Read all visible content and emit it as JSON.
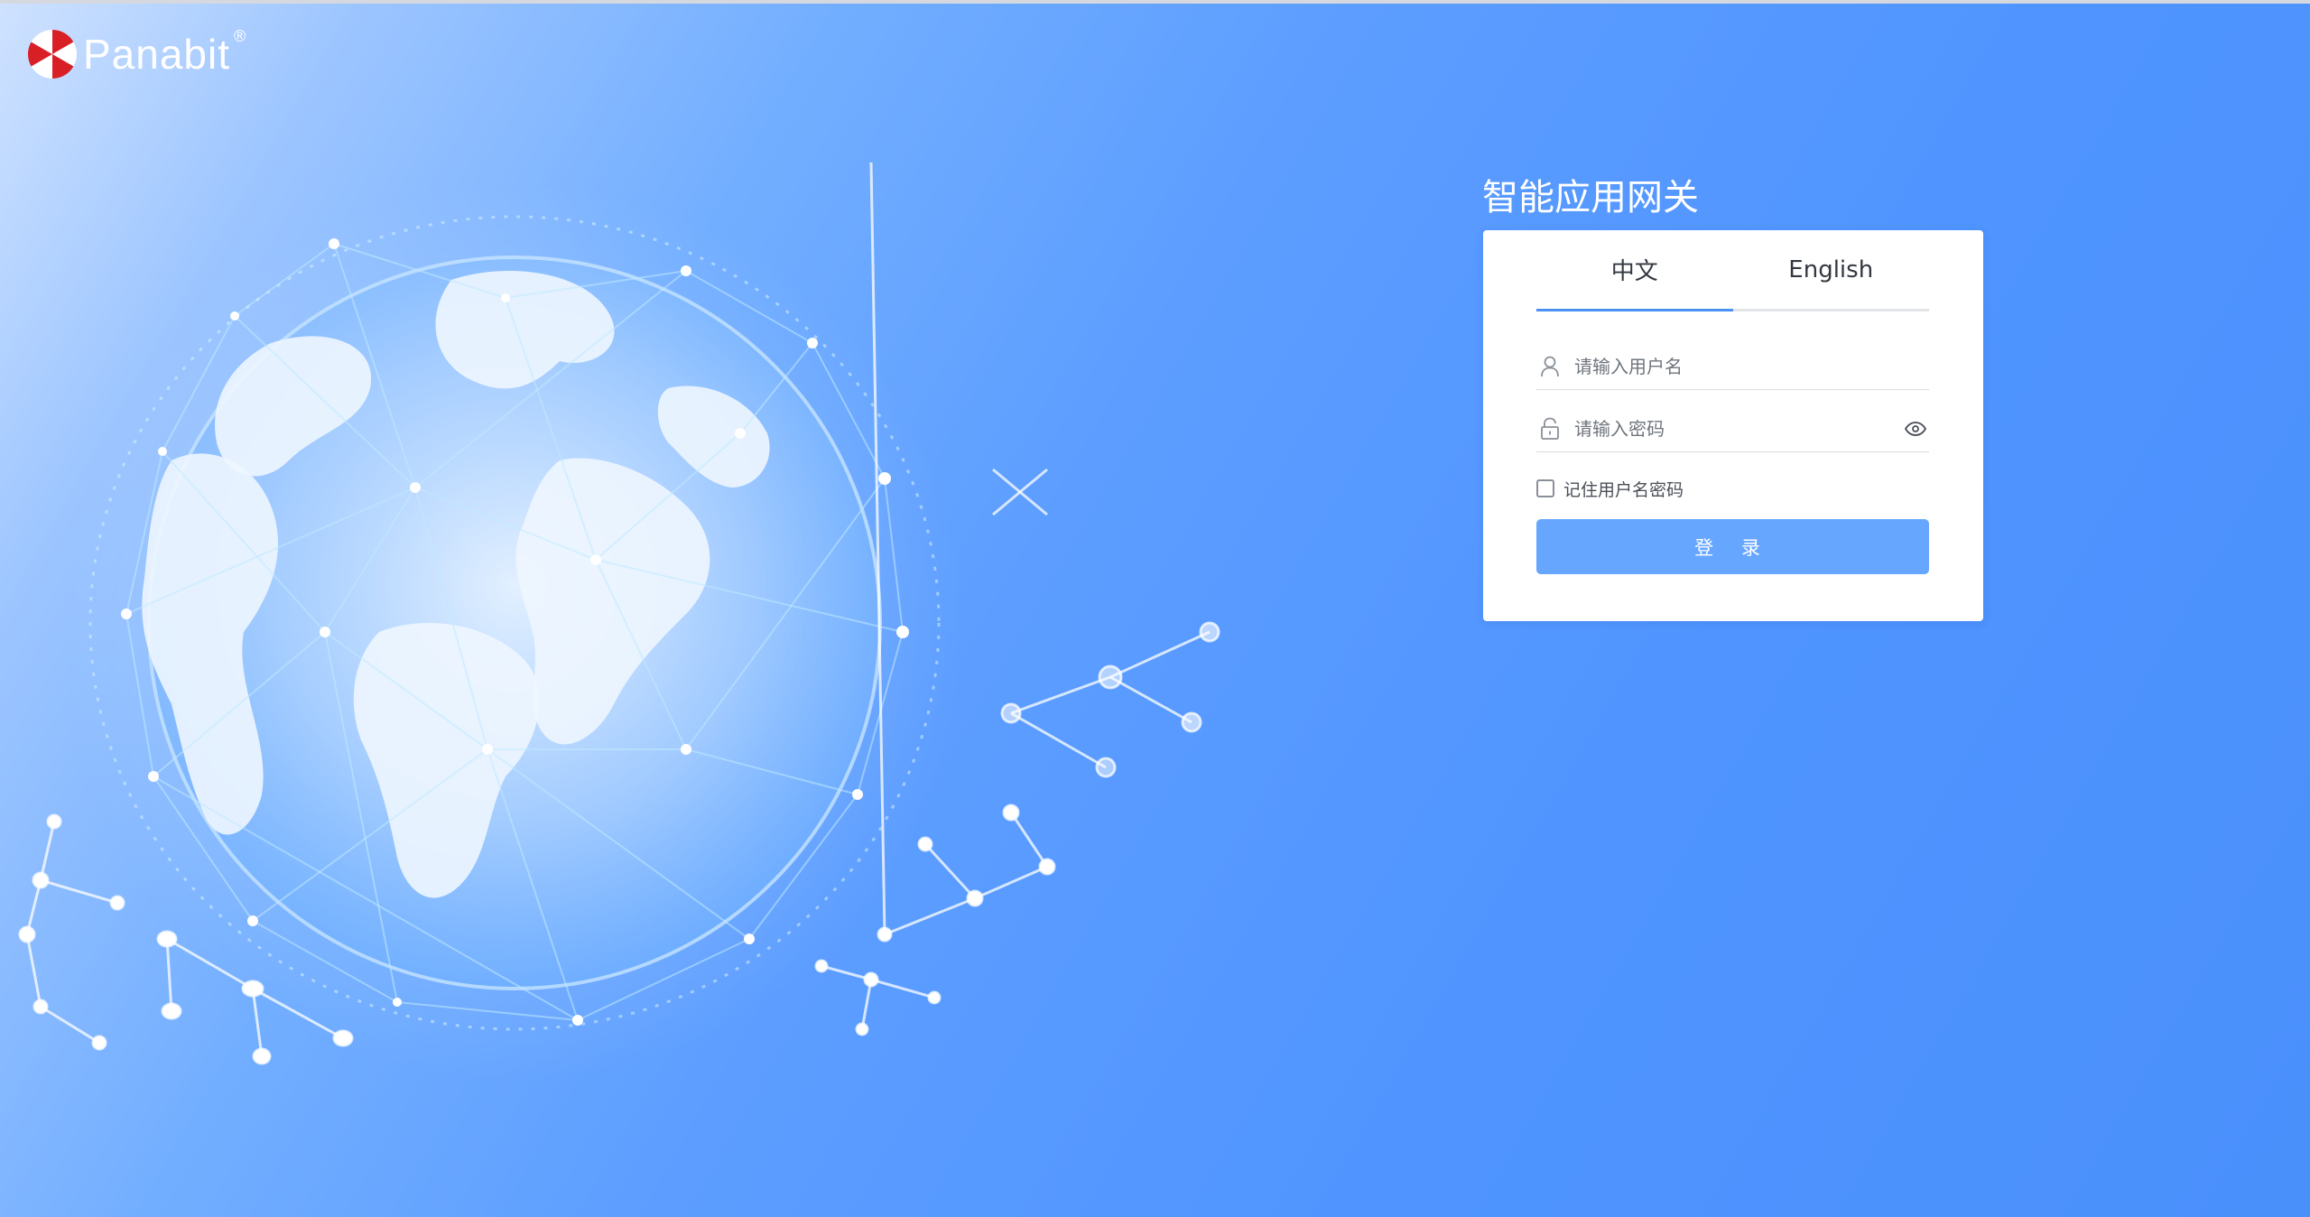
{
  "brand": {
    "name": "Panabit",
    "registered_mark": "®",
    "logo_colors": {
      "red": "#d81f26",
      "white": "#ffffff"
    }
  },
  "app_title": "智能应用网关",
  "login": {
    "tabs": [
      {
        "label": "中文",
        "active": true
      },
      {
        "label": "English",
        "active": false
      }
    ],
    "username": {
      "placeholder": "请输入用户名",
      "value": "",
      "icon": "user-icon"
    },
    "password": {
      "placeholder": "请输入密码",
      "value": "",
      "icon": "lock-icon",
      "toggle_icon": "eye-icon"
    },
    "remember": {
      "label": "记住用户名密码",
      "checked": false
    },
    "submit_label": "登 录"
  },
  "colors": {
    "accent": "#4a90f5",
    "button": "#66a6ff",
    "background": "#4f94ff"
  }
}
